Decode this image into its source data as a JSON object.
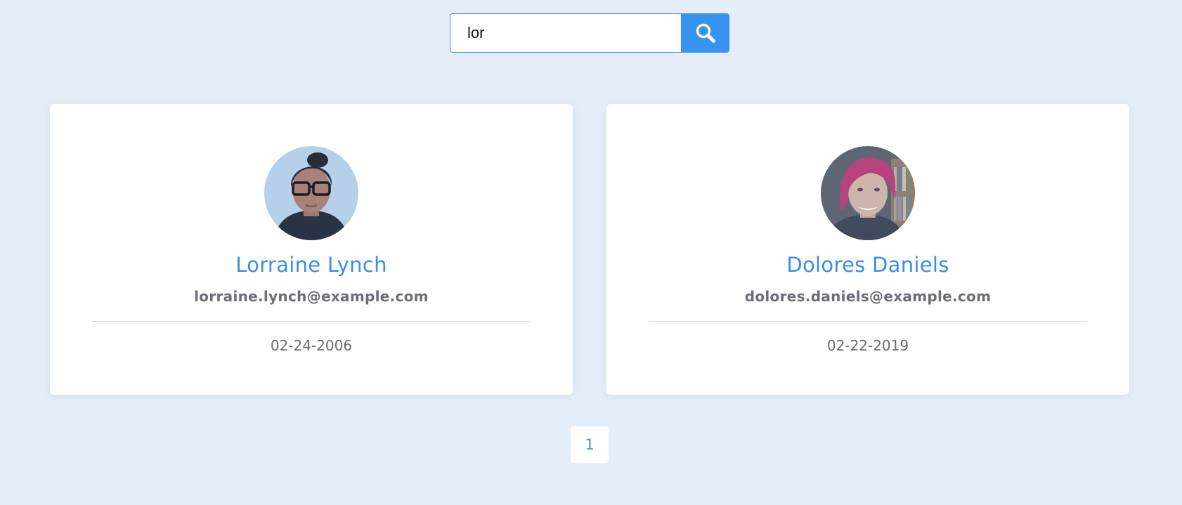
{
  "search": {
    "value": "lor",
    "button_icon": "search-icon",
    "button_color": "#3893f0"
  },
  "cards": [
    {
      "name": "Lorraine Lynch",
      "email": "lorraine.lynch@example.com",
      "date": "02-24-2006",
      "avatar": "avatar-photo"
    },
    {
      "name": "Dolores Daniels",
      "email": "dolores.daniels@example.com",
      "date": "02-22-2019",
      "avatar": "avatar-photo"
    }
  ],
  "pagination": {
    "pages": [
      "1"
    ],
    "current": "1"
  },
  "colors": {
    "background": "#e5edf8",
    "accent": "#3a8ee8",
    "card": "#ffffff",
    "muted_text": "#6d6d77"
  }
}
